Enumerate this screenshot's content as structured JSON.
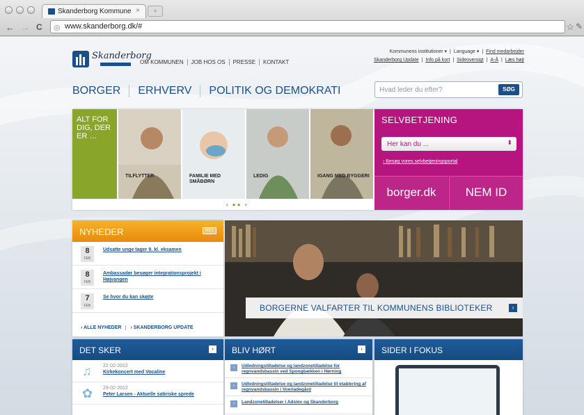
{
  "browser": {
    "tab_title": "Skanderborg Kommune",
    "tab_close": "×",
    "url_scheme": "www.skanderborg.dk",
    "url_path": "/#",
    "back": "←",
    "forward": "→",
    "reload": "C",
    "bookmark": "☆",
    "wrench": "✎"
  },
  "header": {
    "logo_text": "Skanderborg",
    "top_nav": [
      "OM KOMMUNEN",
      "JOB HOS OS",
      "PRESSE",
      "KONTAKT"
    ],
    "utility_row1": [
      "Kommunens institutioner ▾",
      "Language ▾",
      "Find medarbejder"
    ],
    "utility_row2": [
      "Skanderborg Update",
      "Info på kort",
      "Sideoversigt",
      "A-Å",
      "Læs højt"
    ],
    "main_nav": [
      "BORGER",
      "ERHVERV",
      "POLITIK OG DEMOKRATI"
    ],
    "search_placeholder": "Hvad leder du efter?",
    "search_button": "SØG"
  },
  "hero": {
    "slogan": "ALT FOR DIG, DER ER …",
    "tiles": [
      {
        "label": "TILFLYTTER"
      },
      {
        "label": "FAMILIE MED SMÅBØRN"
      },
      {
        "label": "LEDIG"
      },
      {
        "label": "IGANG MED BYGGERI"
      }
    ],
    "pager_prev": "‹",
    "pager_next": "›",
    "pager_dots": "● ●"
  },
  "selvbetjening": {
    "title": "SELVBETJENING",
    "dropdown": "Her kan du ...",
    "link": "Besøg vores selvbetjeningsportal",
    "brand_left": "borger.dk",
    "brand_right": "NEM ID"
  },
  "news": {
    "title": "NYHEDER",
    "rss": "RSS",
    "items": [
      {
        "day": "8",
        "month": "FEB",
        "text": "Udsatte unge tager 9. kl. eksamen"
      },
      {
        "day": "8",
        "month": "FEB",
        "text": "Ambassadør besøger integrationsprojekt i Højvangen"
      },
      {
        "day": "7",
        "month": "FEB",
        "text": "Se hvor du kan skøjte"
      }
    ],
    "footer": [
      "› ALLE NYHEDER",
      "› SKANDERBORG UPDATE"
    ]
  },
  "feature": {
    "caption": "BORGERNE VALFARTER TIL KOMMUNENS BIBLIOTEKER",
    "arrow": "›"
  },
  "det_sker": {
    "title": "DET SKER",
    "arrow": "›",
    "events": [
      {
        "icon": "♫",
        "date": "22-02-2012",
        "name": "Kirkekoncert med Vocaline"
      },
      {
        "icon": "✿",
        "date": "23-02-2012",
        "name": "Peter Larsen - Aktuelle satiriske sprede"
      }
    ]
  },
  "bliv_hoert": {
    "title": "BLIV HØRT",
    "arrow": "›",
    "items": [
      "Udledningstilladelse og landzonetilladelse for regnvandsbassin ved Spongbækken i Hørning",
      "Udledningstilladelse og landzonetilladelse til etablering af regnvandsbassin i Voerladegård",
      "Landzonetilladelser i Adslev og Skanderborg"
    ]
  },
  "sider_i_fokus": {
    "title": "SIDER I FOKUS"
  },
  "colors": {
    "brand_blue": "#1b4f8a",
    "magenta": "#b6147e",
    "green": "#8aa62a",
    "orange": "#f5a623"
  }
}
